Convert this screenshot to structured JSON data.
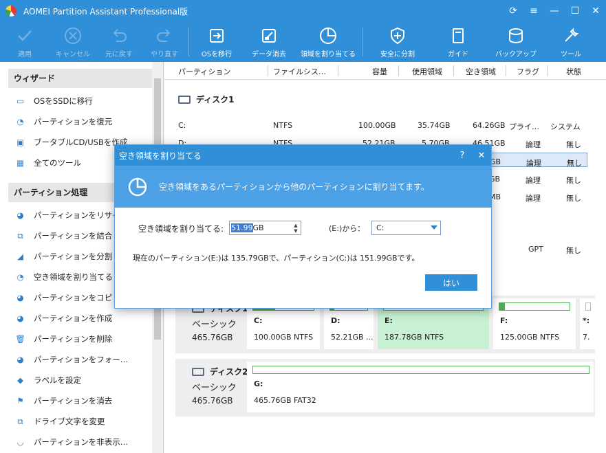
{
  "window": {
    "title": "AOMEI Partition Assistant Professional版"
  },
  "toolbar": [
    {
      "label": "適用",
      "icon": "check-icon",
      "enabled": false
    },
    {
      "label": "キャンセル",
      "icon": "cancel-icon",
      "enabled": false
    },
    {
      "label": "元に戻す",
      "icon": "undo-icon",
      "enabled": false
    },
    {
      "label": "やり直す",
      "icon": "redo-icon",
      "enabled": false
    },
    {
      "label": "OSを移行",
      "icon": "migrate-os-icon",
      "enabled": true
    },
    {
      "label": "データ消去",
      "icon": "wipe-data-icon",
      "enabled": true
    },
    {
      "label": "領域を割り当てる",
      "icon": "allocate-space-icon",
      "enabled": true
    },
    {
      "label": "安全に分割",
      "icon": "safe-split-icon",
      "enabled": true
    },
    {
      "label": "ガイド",
      "icon": "guide-icon",
      "enabled": true
    },
    {
      "label": "バックアップ",
      "icon": "backup-icon",
      "enabled": true
    },
    {
      "label": "ツール",
      "icon": "tools-icon",
      "enabled": true
    }
  ],
  "sidebar": {
    "wizard_title": "ウィザード",
    "wizard_items": [
      {
        "label": "OSをSSDに移行",
        "icon": "disk-migrate-icon"
      },
      {
        "label": "パーティションを復元",
        "icon": "partition-recover-icon"
      },
      {
        "label": "ブータブルCD/USBを作成",
        "icon": "bootable-media-icon"
      },
      {
        "label": "全てのツール",
        "icon": "all-tools-icon"
      }
    ],
    "ops_title": "パーティション処理",
    "ops_items": [
      {
        "label": "パーティションをリサイ",
        "icon": "resize-icon"
      },
      {
        "label": "パーティションを結合",
        "icon": "merge-icon"
      },
      {
        "label": "パーティションを分割",
        "icon": "split-icon"
      },
      {
        "label": "空き領域を割り当てる",
        "icon": "allocate-icon"
      },
      {
        "label": "パーティションをコピ",
        "icon": "copy-icon"
      },
      {
        "label": "パーティションを作成",
        "icon": "create-icon"
      },
      {
        "label": "パーティションを削除",
        "icon": "delete-icon"
      },
      {
        "label": "パーティションをフォー…",
        "icon": "format-icon"
      },
      {
        "label": "ラベルを設定",
        "icon": "label-icon"
      },
      {
        "label": "パーティションを消去",
        "icon": "wipe-icon"
      },
      {
        "label": "ドライブ文字を変更",
        "icon": "drive-letter-icon"
      },
      {
        "label": "パーティションを非表示…",
        "icon": "hide-icon"
      }
    ]
  },
  "columns": [
    "パーティション",
    "ファイルシス…",
    "容量",
    "使用領域",
    "空き領域",
    "フラグ",
    "状態"
  ],
  "disk1": {
    "title": "ディスク1",
    "rows": [
      {
        "part": "C:",
        "fs": "NTFS",
        "cap": "100.00GB",
        "used": "35.74GB",
        "free": "64.26GB",
        "flag": "プライ…",
        "status": "システム"
      },
      {
        "part": "D:",
        "fs": "NTFS",
        "cap": "52.21GB",
        "used": "5.70GB",
        "free": "46.51GB",
        "flag": "論理",
        "status": "無し"
      },
      {
        "part": "",
        "fs": "",
        "cap": "",
        "used": "",
        "free": "GB",
        "flag": "論理",
        "status": "無し"
      },
      {
        "part": "",
        "fs": "",
        "cap": "",
        "used": "",
        "free": "GB",
        "flag": "論理",
        "status": "無し"
      },
      {
        "part": "",
        "fs": "",
        "cap": "",
        "used": "",
        "free": "MB",
        "flag": "論理",
        "status": "無し"
      }
    ],
    "gpt_row": {
      "flag": "GPT",
      "status": "無し"
    }
  },
  "diskmap": [
    {
      "name": "ディスク1",
      "type": "ベーシック",
      "size": "465.76GB",
      "parts": [
        {
          "letter": "C:",
          "info": "100.00GB NTFS",
          "used": 0.36
        },
        {
          "letter": "D:",
          "info": "52.21GB ...",
          "used": 0.11
        },
        {
          "letter": "E:",
          "info": "187.78GB NTFS",
          "used": 0.0
        },
        {
          "letter": "F:",
          "info": "125.00GB NTFS",
          "used": 0.08
        },
        {
          "letter": "*:",
          "info": "7.",
          "used": 0.0
        }
      ]
    },
    {
      "name": "ディスク2",
      "type": "ベーシック",
      "size": "465.76GB",
      "parts": [
        {
          "letter": "G:",
          "info": "465.76GB FAT32",
          "used": 0.0
        }
      ]
    }
  ],
  "dialog": {
    "title": "空き領域を割り当てる",
    "help": "?",
    "close": "✕",
    "banner": "空き領域をあるパーティションから他のパーティションに割り当てます。",
    "amount_label": "空き領域を割り当てる:",
    "amount_value_selected": "51.99",
    "amount_unit": "GB",
    "from_label": "(E:)から：",
    "from_value": "C:",
    "description": "現在のパーティション(E:)は 135.79GBで、パーティション(C:)は 151.99GBです。",
    "ok_label": "はい"
  }
}
